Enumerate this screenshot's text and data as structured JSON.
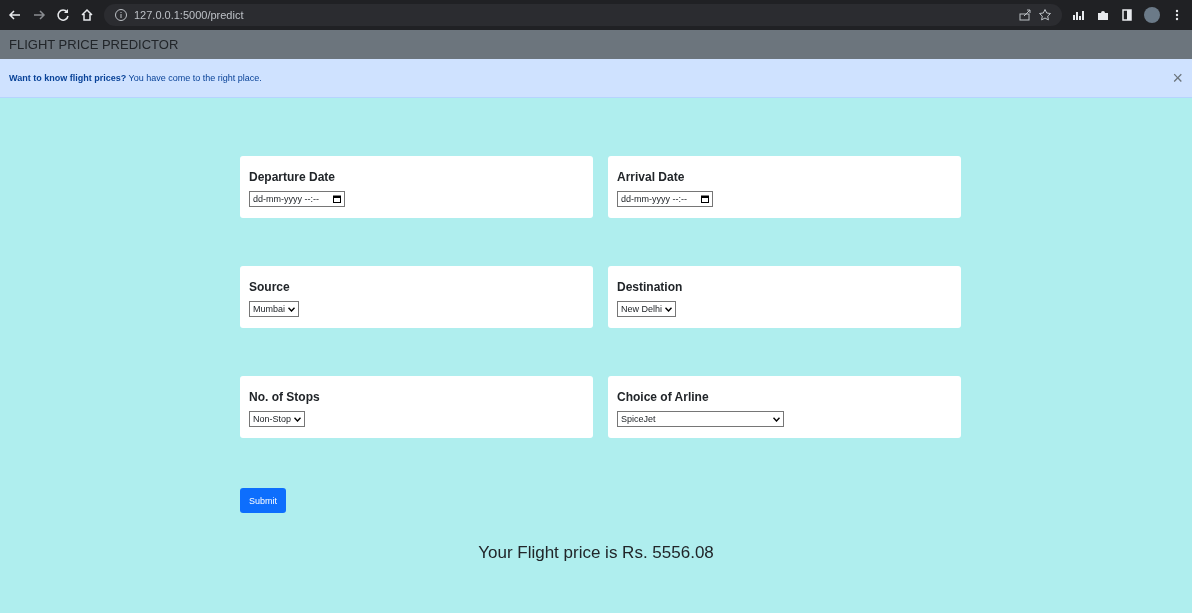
{
  "browser": {
    "url": "127.0.0.1:5000/predict"
  },
  "navbar": {
    "title": "FLIGHT PRICE PREDICTOR"
  },
  "alert": {
    "text": "**Want to know flight prices?** You have come to the right place.",
    "close": "×"
  },
  "fields": [
    {
      "kind": "datetime",
      "label": "Departure Date",
      "placeholder": "dd-mm-yyyy --:--"
    },
    {
      "kind": "datetime",
      "label": "Arrival Date",
      "placeholder": "dd-mm-yyyy --:--"
    },
    {
      "kind": "select",
      "label": "Source",
      "value": "Mumbai",
      "wide": false
    },
    {
      "kind": "select",
      "label": "Destination",
      "value": "New Delhi",
      "wide": false
    },
    {
      "kind": "select",
      "label": "No. of Stops",
      "value": "Non-Stop",
      "wide": false
    },
    {
      "kind": "select",
      "label": "Choice of Arline",
      "value": "SpiceJet",
      "wide": true
    }
  ],
  "submit": "Submit",
  "result": "Your Flight price is Rs. 5556.08"
}
